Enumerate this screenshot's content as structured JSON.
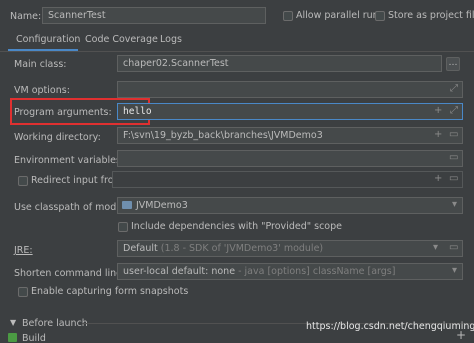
{
  "header": {
    "name_label": "Name:",
    "name_value": "ScannerTest",
    "allow_parallel_label": "Allow parallel run",
    "store_label": "Store as project file"
  },
  "tabs": [
    {
      "label": "Configuration",
      "active": true
    },
    {
      "label": "Code Coverage",
      "active": false
    },
    {
      "label": "Logs",
      "active": false
    }
  ],
  "form": {
    "main_class_label": "Main class:",
    "main_class_value": "chaper02.ScannerTest",
    "vm_options_label": "VM options:",
    "vm_options_value": "",
    "program_args_label": "Program arguments:",
    "program_args_value": "hello",
    "working_dir_label": "Working directory:",
    "working_dir_value": "F:\\svn\\19_byzb_back\\branches\\JVMDemo3",
    "env_vars_label": "Environment variables:",
    "env_vars_value": "",
    "redirect_label": "Redirect input from:",
    "classpath_label": "Use classpath of module:",
    "classpath_value": "JVMDemo3",
    "include_deps_label": "Include dependencies with \"Provided\" scope",
    "jre_label": "JRE:",
    "jre_value_main": "Default",
    "jre_value_hint": "(1.8 - SDK of 'JVMDemo3' module)",
    "shorten_label": "Shorten command line:",
    "shorten_value_main": "user-local default: none",
    "shorten_value_hint": "- java [options] className [args]",
    "snapshots_label": "Enable capturing form snapshots"
  },
  "before_launch": {
    "label": "Before launch",
    "build_label": "Build"
  },
  "watermark": "https://blog.csdn.net/chengqiuming",
  "colors": {
    "background": "#3c3f41",
    "field": "#45494a",
    "focus": "#4a88c7",
    "highlight_box": "#e03030"
  }
}
